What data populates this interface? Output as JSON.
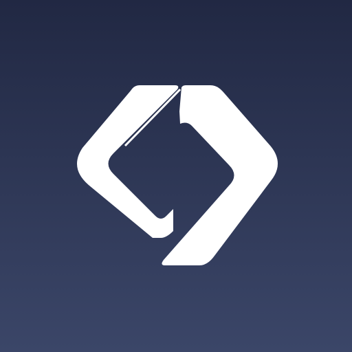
{
  "icon": {
    "logo_name": "diamond-link-logo",
    "colors": {
      "background_top": "#212843",
      "background_bottom": "#3b4668",
      "mark": "#ffffff"
    }
  }
}
